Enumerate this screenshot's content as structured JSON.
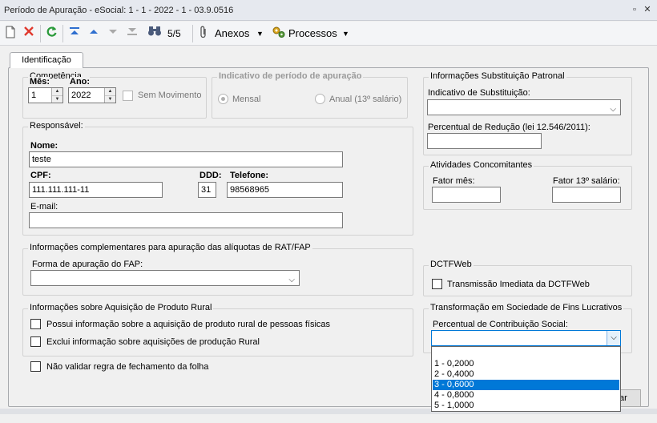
{
  "window": {
    "title": "Período de Apuração - eSocial: 1 - 1 - 2022 - 1 - 03.9.0516"
  },
  "toolbar": {
    "pager": "5/5",
    "anexos_label": "Anexos",
    "processos_label": "Processos"
  },
  "tabs": [
    {
      "label": "Identificação"
    }
  ],
  "competencia": {
    "legend": "Competência",
    "mes_label": "Mês:",
    "mes_value": "1",
    "ano_label": "Ano:",
    "ano_value": "2022",
    "sem_movimento_label": "Sem Movimento"
  },
  "indicativo": {
    "legend": "Indicativo de período de apuração",
    "mensal_label": "Mensal",
    "anual_label": "Anual (13º salário)"
  },
  "responsavel": {
    "legend": "Responsável:",
    "nome_label": "Nome:",
    "nome_value": "teste",
    "cpf_label": "CPF:",
    "cpf_value": "111.111.111-11",
    "ddd_label": "DDD:",
    "ddd_value": "31",
    "telefone_label": "Telefone:",
    "telefone_value": "98568965",
    "email_label": "E-mail:",
    "email_value": ""
  },
  "substituicao": {
    "legend": "Informações Substituição Patronal",
    "indicativo_label": "Indicativo de Substituição:",
    "indicativo_value": "",
    "percentual_label": "Percentual de Redução  (lei 12.546/2011):",
    "percentual_value": ""
  },
  "atividades": {
    "legend": "Atividades Concomitantes",
    "fator_mes_label": "Fator mês:",
    "fator_mes_value": "",
    "fator_13_label": "Fator 13º salário:",
    "fator_13_value": ""
  },
  "rat_fap": {
    "legend": "Informações complementares para apuração das alíquotas de RAT/FAP",
    "forma_label": "Forma de apuração do FAP:",
    "forma_value": ""
  },
  "dctfweb": {
    "legend": "DCTFWeb",
    "transmissao_label": "Transmissão Imediata da DCTFWeb"
  },
  "produto_rural": {
    "legend": "Informações sobre Aquisição de Produto Rural",
    "possui_label": "Possui informação sobre a aquisição de produto rural de pessoas físicas",
    "exclui_label": "Exclui informação sobre aquisições de produção Rural"
  },
  "nao_validar_label": "Não validar regra de fechamento da folha",
  "transformacao": {
    "legend": "Transformação em Sociedade de Fins Lucrativos",
    "percentual_label": "Percentual de Contribuição Social:",
    "percentual_value": "",
    "options": [
      "1 - 0,2000",
      "2 - 0,4000",
      "3 - 0,6000",
      "4 - 0,8000",
      "5 - 1,0000"
    ],
    "selected_index": 2
  },
  "buttons": {
    "partial_label": "ar"
  },
  "colors": {
    "selection": "#0078d7",
    "cancel_icon": "#e03a2f",
    "refresh_icon": "#2a9a3a",
    "nav_icon": "#2f6fcf"
  }
}
